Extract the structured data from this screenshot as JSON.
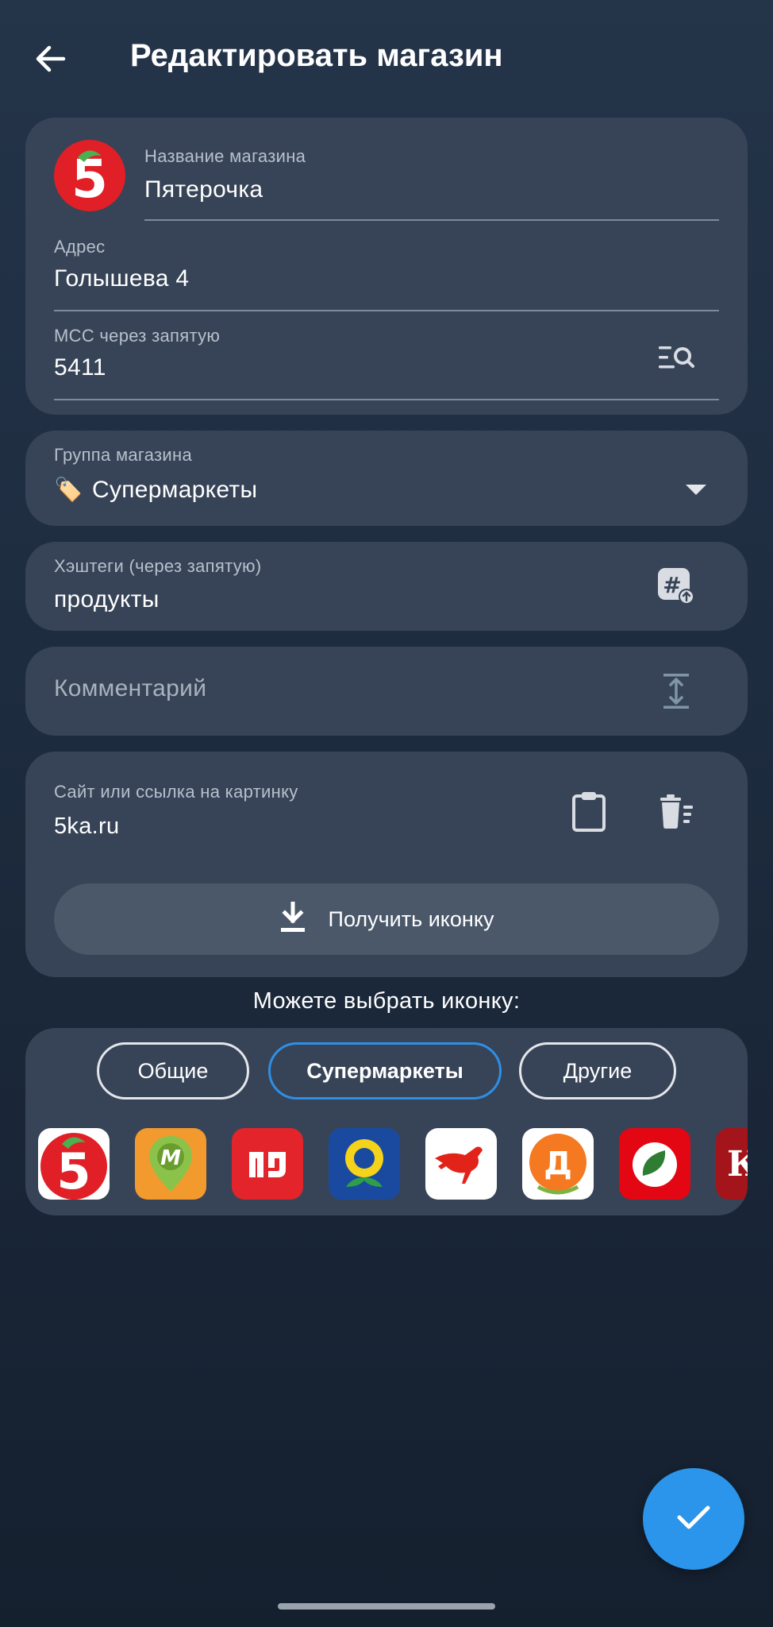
{
  "header": {
    "title": "Редактировать магазин"
  },
  "store_form": {
    "name_label": "Название магазина",
    "name_value": "Пятерочка",
    "address_label": "Адрес",
    "address_value": "Голышева 4",
    "mcc_label": "MCC через запятую",
    "mcc_value": "5411"
  },
  "group": {
    "label": "Группа магазина",
    "emoji": "🏷️",
    "value": "Супермаркеты"
  },
  "hashtags": {
    "label": "Хэштеги (через запятую)",
    "value": "продукты"
  },
  "comment": {
    "placeholder": "Комментарий"
  },
  "site": {
    "label": "Сайт или ссылка на картинку",
    "value": "5ka.ru",
    "get_icon_label": "Получить иконку"
  },
  "icon_picker": {
    "title": "Можете выбрать иконку:",
    "tabs": [
      {
        "label": "Общие"
      },
      {
        "label": "Супермаркеты"
      },
      {
        "label": "Другие"
      }
    ],
    "active_tab": "Супермаркеты",
    "icons": [
      "pyaterochka-icon",
      "monetka-icon",
      "magnit-icon",
      "lenta-icon",
      "auchan-icon",
      "dixy-icon",
      "perekrestok-icon",
      "krasnoe-beloe-icon"
    ]
  },
  "colors": {
    "accent": "#2a95ea",
    "card": "#374457",
    "active_tab_border": "#2e8fe6"
  }
}
